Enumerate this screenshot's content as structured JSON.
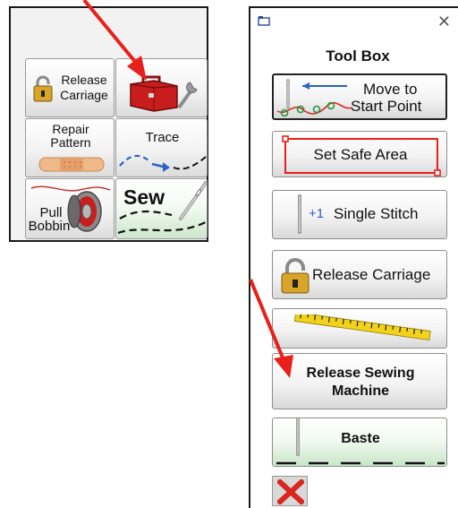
{
  "palette": {
    "release_carriage_line1": "Release",
    "release_carriage_line2": "Carriage",
    "repair_line1": "Repair",
    "repair_line2": "Pattern",
    "trace_label": "Trace",
    "pull_bobbin_line1": "Pull",
    "pull_bobbin_line2": "Bobbin",
    "sew_label": "Sew"
  },
  "toolbox": {
    "title": "Tool Box",
    "move_line1": "Move to",
    "move_line2": "Start Point",
    "safe_area_label": "Set Safe Area",
    "single_prefix": "+1",
    "single_label": "Single Stitch",
    "release_carriage_label": "Release Carriage",
    "release_sewing_line1": "Release Sewing",
    "release_sewing_line2": "Machine",
    "baste_label": "Baste"
  },
  "colors": {
    "arrow": "#e8201c",
    "accent_blue": "#2b63c6",
    "sew_green": "#cbe8cb"
  },
  "icons": {
    "close": "close-icon",
    "toolbox": "toolbox-icon",
    "lock": "padlock-icon"
  }
}
